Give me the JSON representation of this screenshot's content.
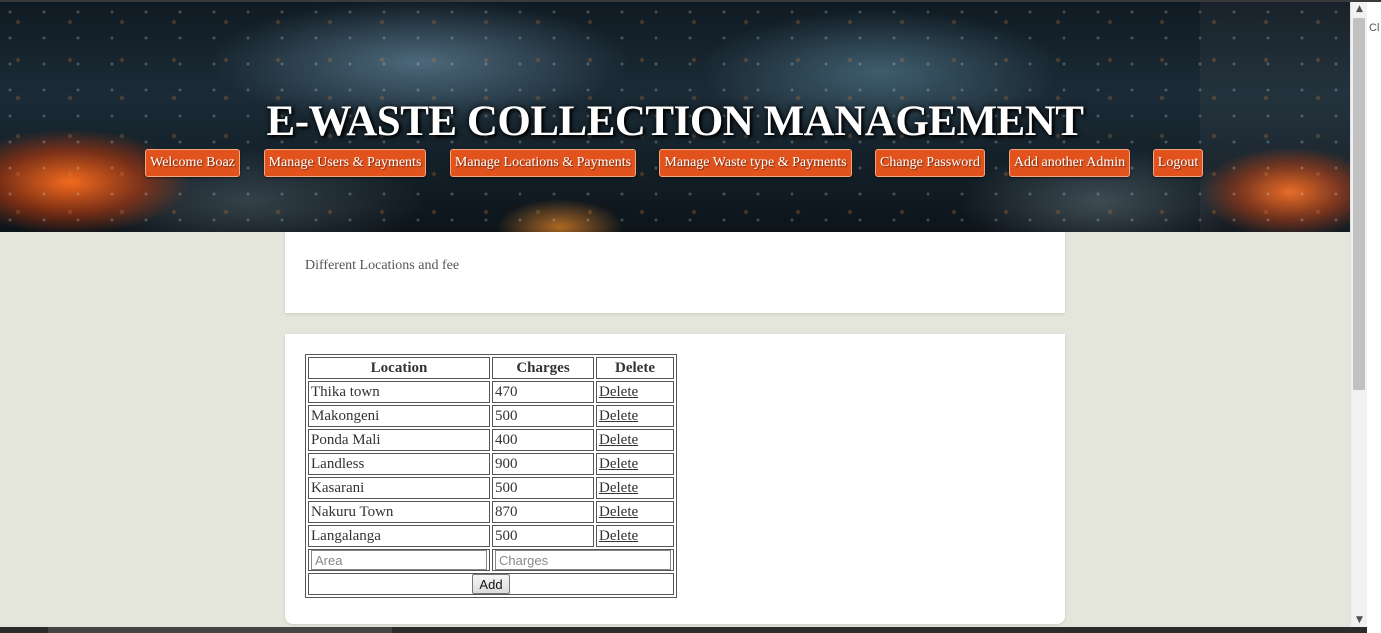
{
  "header": {
    "title": "E-WASTE COLLECTION MANAGEMENT",
    "nav": [
      {
        "label": "Welcome Boaz"
      },
      {
        "label": "Manage Users & Payments"
      },
      {
        "label": "Manage Locations & Payments"
      },
      {
        "label": "Manage Waste type & Payments"
      },
      {
        "label": "Change Password"
      },
      {
        "label": "Add another Admin"
      },
      {
        "label": "Logout"
      }
    ]
  },
  "info": {
    "text": "Different Locations and fee"
  },
  "table": {
    "headers": {
      "location": "Location",
      "charges": "Charges",
      "delete": "Delete"
    },
    "rows": [
      {
        "location": "Thika town",
        "charges": "470",
        "action": "Delete"
      },
      {
        "location": "Makongeni",
        "charges": "500",
        "action": "Delete"
      },
      {
        "location": "Ponda Mali",
        "charges": "400",
        "action": "Delete"
      },
      {
        "location": "Landless",
        "charges": "900",
        "action": "Delete"
      },
      {
        "location": "Kasarani",
        "charges": "500",
        "action": "Delete"
      },
      {
        "location": "Nakuru Town",
        "charges": "870",
        "action": "Delete"
      },
      {
        "location": "Langalanga",
        "charges": "500",
        "action": "Delete"
      }
    ],
    "form": {
      "area_placeholder": "Area",
      "charges_placeholder": "Charges",
      "add_label": "Add"
    }
  },
  "browser": {
    "side_text": "Cl",
    "scroll_up": "▲",
    "scroll_down": "▼"
  },
  "colors": {
    "nav_button": "#e2521c",
    "page_background": "#e5e6db"
  }
}
